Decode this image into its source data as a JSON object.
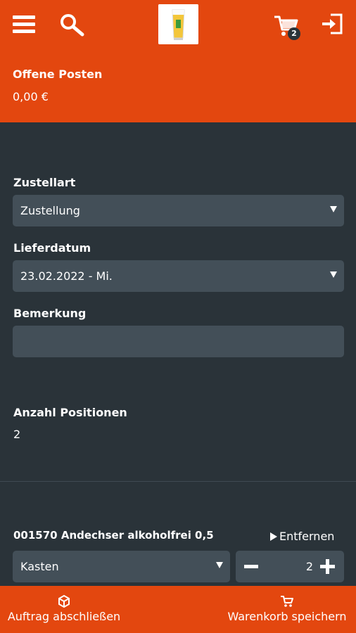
{
  "header": {
    "menu_icon": "hamburger-menu-icon",
    "search_icon": "magnifier-icon",
    "logo_icon": "beer-glass-logo",
    "cart_icon": "shopping-cart-icon",
    "cart_count": "2",
    "logout_icon": "sign-out-icon"
  },
  "account": {
    "title": "Offene Posten",
    "value": "0,00 €"
  },
  "form": {
    "delivery_type_label": "Zustellart",
    "delivery_type_value": "Zustellung",
    "delivery_date_label": "Lieferdatum",
    "delivery_date_value": "23.02.2022 - Mi.",
    "remark_label": "Bemerkung",
    "remark_value": ""
  },
  "summary": {
    "positions_label": "Anzahl Positionen",
    "positions_value": "2"
  },
  "item": {
    "title": "001570 Andechser alkoholfrei 0,5",
    "remove_label": "Entfernen",
    "unit_value": "Kasten",
    "quantity": "2"
  },
  "footer": {
    "finish_label": "Auftrag abschließen",
    "finish_icon": "box-icon",
    "save_label": "Warenkorb speichern",
    "save_icon": "cart-icon"
  },
  "colors": {
    "accent": "#e3470f",
    "background": "#2a3339",
    "field": "#434f58"
  }
}
